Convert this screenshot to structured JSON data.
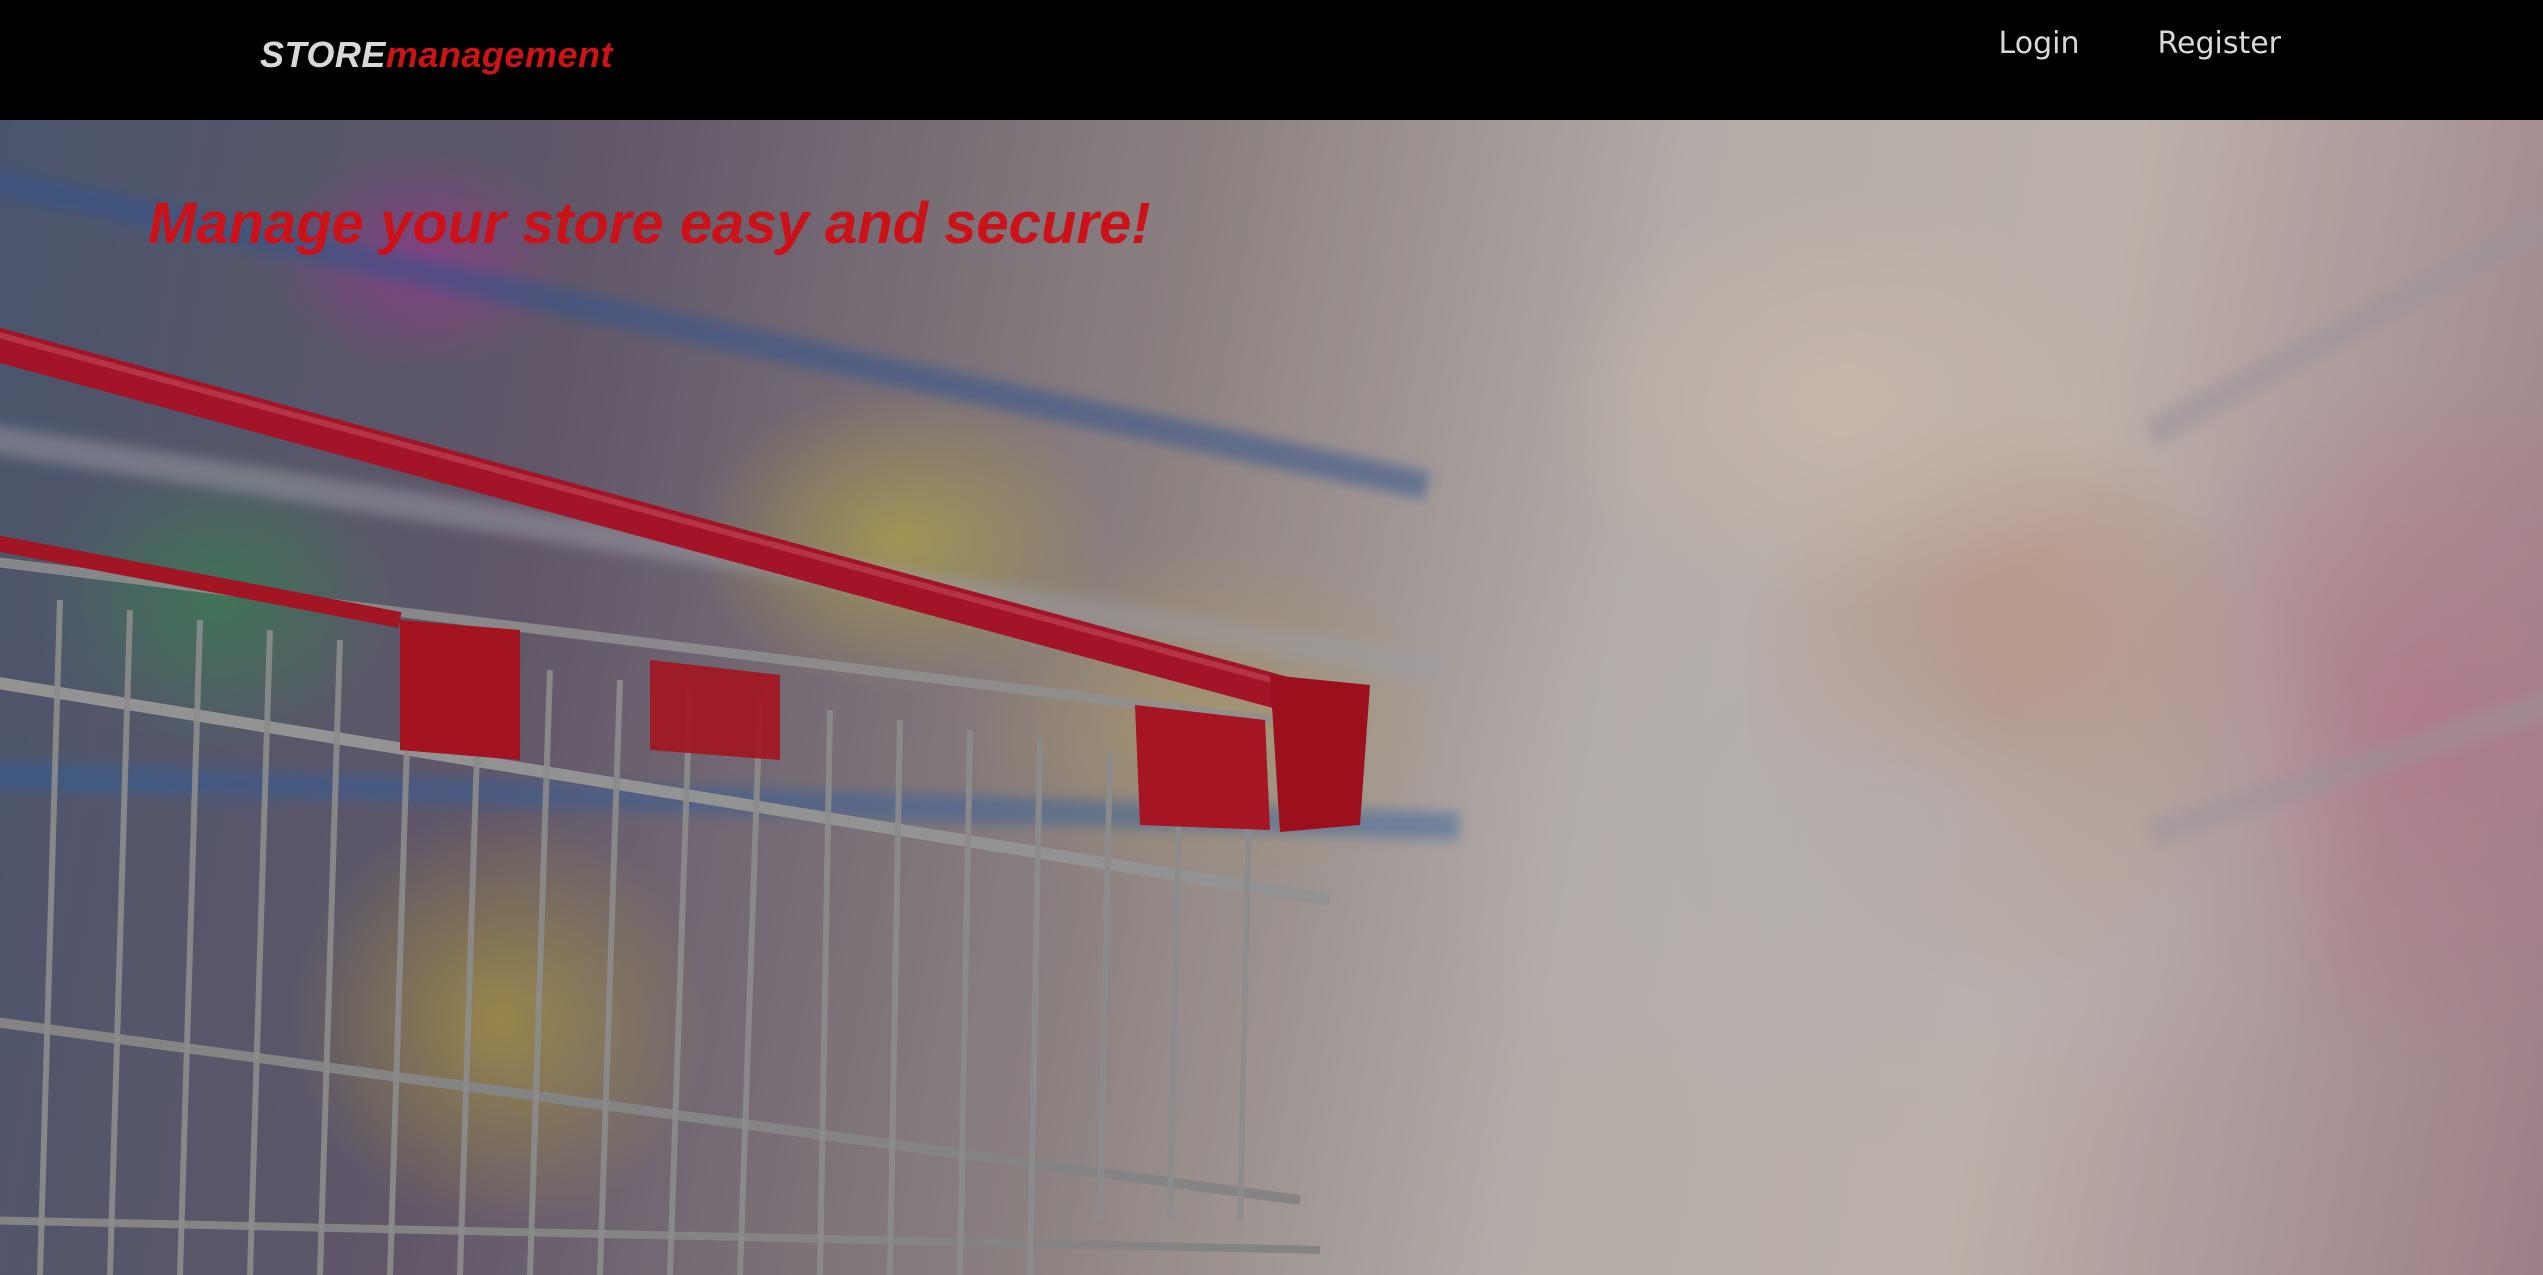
{
  "navbar": {
    "brand_prefix": "STORE",
    "brand_suffix": "management",
    "links": [
      {
        "label": "Login"
      },
      {
        "label": "Register"
      }
    ]
  },
  "hero": {
    "title": "Manage your store easy and secure!",
    "background_image": "blurred supermarket aisle with red shopping cart"
  },
  "colors": {
    "navbar_bg": "#000000",
    "brand_accent": "#cc1416",
    "brand_light": "#d9d9d9",
    "nav_link": "#d8d8d8",
    "hero_title": "#cc1118"
  }
}
